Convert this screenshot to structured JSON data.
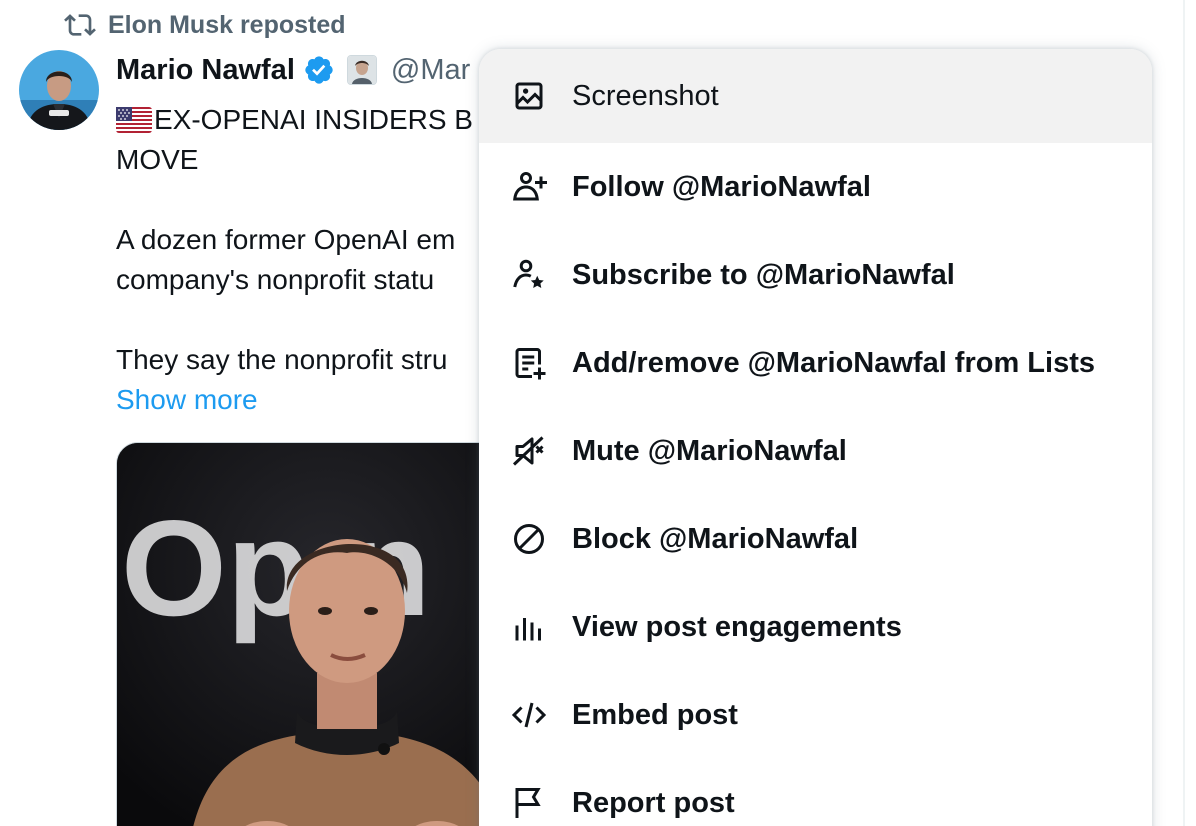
{
  "repost": {
    "icon": "repost-icon",
    "text": "Elon Musk reposted"
  },
  "tweet": {
    "author_name": "Mario Nawfal",
    "verified_icon": "verified-badge-icon",
    "verified_color": "#1d9bf0",
    "handle": "@Mar",
    "line1": "EX-OPENAI INSIDERS B",
    "line2": "MOVE",
    "line3": "A dozen former OpenAI em",
    "line4": "company's nonprofit statu",
    "line5": "They say the nonprofit stru",
    "show_more": "Show more",
    "link_color": "#1d9bf0",
    "media_text": "Op n"
  },
  "menu": {
    "items": [
      {
        "icon": "image-icon",
        "label": "Screenshot"
      },
      {
        "icon": "follow-user-icon",
        "label": "Follow @MarioNawfal"
      },
      {
        "icon": "subscribe-star-icon",
        "label": "Subscribe to @MarioNawfal"
      },
      {
        "icon": "list-add-icon",
        "label": "Add/remove @MarioNawfal from Lists"
      },
      {
        "icon": "mute-speaker-icon",
        "label": "Mute @MarioNawfal"
      },
      {
        "icon": "block-icon",
        "label": "Block @MarioNawfal"
      },
      {
        "icon": "engagements-bars-icon",
        "label": "View post engagements"
      },
      {
        "icon": "embed-code-icon",
        "label": "Embed post"
      },
      {
        "icon": "flag-icon",
        "label": "Report post"
      }
    ]
  }
}
